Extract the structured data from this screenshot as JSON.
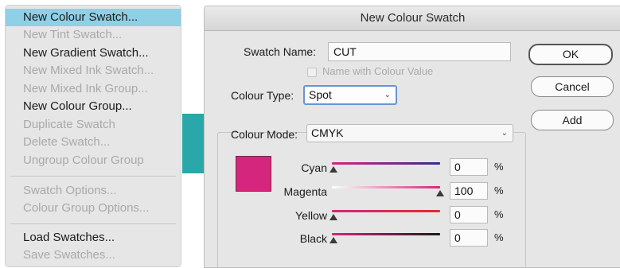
{
  "menu": {
    "items": [
      {
        "label": "New Colour Swatch...",
        "state": "highlighted"
      },
      {
        "label": "New Tint Swatch...",
        "state": "disabled"
      },
      {
        "label": "New Gradient Swatch...",
        "state": "enabled"
      },
      {
        "label": "New Mixed Ink Swatch...",
        "state": "disabled"
      },
      {
        "label": "New Mixed Ink Group...",
        "state": "disabled"
      },
      {
        "label": "New Colour Group...",
        "state": "enabled"
      },
      {
        "label": "Duplicate Swatch",
        "state": "disabled"
      },
      {
        "label": "Delete Swatch...",
        "state": "disabled"
      },
      {
        "label": "Ungroup Colour Group",
        "state": "disabled"
      },
      {
        "label": "Swatch Options...",
        "state": "disabled"
      },
      {
        "label": "Colour Group Options...",
        "state": "disabled"
      },
      {
        "label": "Load Swatches...",
        "state": "enabled"
      },
      {
        "label": "Save Swatches...",
        "state": "disabled"
      }
    ]
  },
  "dialog": {
    "title": "New Colour Swatch",
    "swatch_name_label": "Swatch Name:",
    "swatch_name_value": "CUT",
    "name_with_value_label": "Name with Colour Value",
    "colour_type_label": "Colour Type:",
    "colour_type_value": "Spot",
    "colour_mode_label": "Colour Mode:",
    "colour_mode_value": "CMYK",
    "buttons": {
      "ok": "OK",
      "cancel": "Cancel",
      "add": "Add"
    },
    "preview_color": "#d5267d",
    "channels": [
      {
        "name": "Cyan",
        "value": "0",
        "unit": "%",
        "level": 0
      },
      {
        "name": "Magenta",
        "value": "100",
        "unit": "%",
        "level": 100
      },
      {
        "name": "Yellow",
        "value": "0",
        "unit": "%",
        "level": 0
      },
      {
        "name": "Black",
        "value": "0",
        "unit": "%",
        "level": 0
      }
    ]
  },
  "colors": {
    "menu_highlight": "#8fd0e6",
    "accent_bar": "#2aa7a8"
  }
}
